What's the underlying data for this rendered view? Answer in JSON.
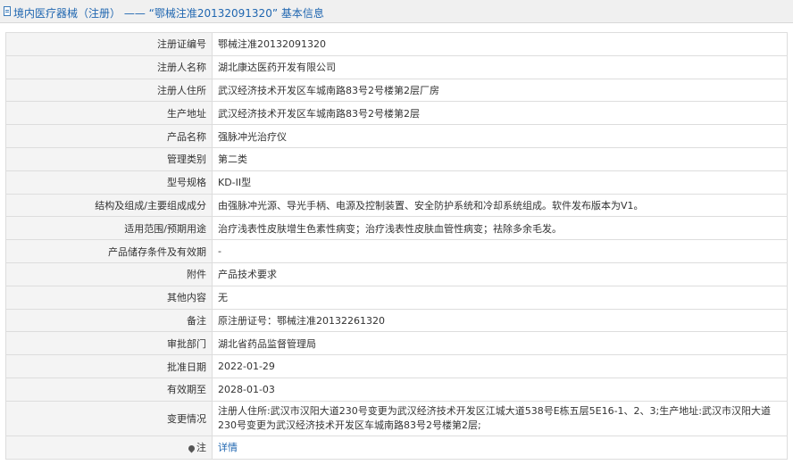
{
  "header": {
    "title": "境内医疗器械（注册） ——  “鄂械注准20132091320”  基本信息",
    "icon": "document-icon"
  },
  "rows": [
    {
      "label": "注册证编号",
      "value": "鄂械注准20132091320"
    },
    {
      "label": "注册人名称",
      "value": "湖北康达医药开发有限公司"
    },
    {
      "label": "注册人住所",
      "value": "武汉经济技术开发区车城南路83号2号楼第2层厂房"
    },
    {
      "label": "生产地址",
      "value": "武汉经济技术开发区车城南路83号2号楼第2层"
    },
    {
      "label": "产品名称",
      "value": "强脉冲光治疗仪"
    },
    {
      "label": "管理类别",
      "value": "第二类"
    },
    {
      "label": "型号规格",
      "value": "KD-II型"
    },
    {
      "label": "结构及组成/主要组成成分",
      "value": "由强脉冲光源、导光手柄、电源及控制装置、安全防护系统和冷却系统组成。软件发布版本为V1。"
    },
    {
      "label": "适用范围/预期用途",
      "value": "治疗浅表性皮肤增生色素性病变；治疗浅表性皮肤血管性病变；祛除多余毛发。"
    },
    {
      "label": "产品储存条件及有效期",
      "value": "-"
    },
    {
      "label": "附件",
      "value": "产品技术要求"
    },
    {
      "label": "其他内容",
      "value": "无"
    },
    {
      "label": "备注",
      "value": "原注册证号：鄂械注准20132261320"
    },
    {
      "label": "审批部门",
      "value": "湖北省药品监督管理局"
    },
    {
      "label": "批准日期",
      "value": "2022-01-29"
    },
    {
      "label": "有效期至",
      "value": "2028-01-03"
    },
    {
      "label": "变更情况",
      "value": "注册人住所:武汉市汉阳大道230号变更为武汉经济技术开发区江城大道538号E栋五层5E16-1、2、3;生产地址:武汉市汉阳大道230号变更为武汉经济技术开发区车城南路83号2号楼第2层;"
    },
    {
      "label": "注",
      "value": "详情",
      "icon": "location-pin-icon"
    }
  ],
  "colors": {
    "accent": "#1f66b0",
    "label_bg": "#f4f4f4",
    "border": "#dddddd"
  }
}
